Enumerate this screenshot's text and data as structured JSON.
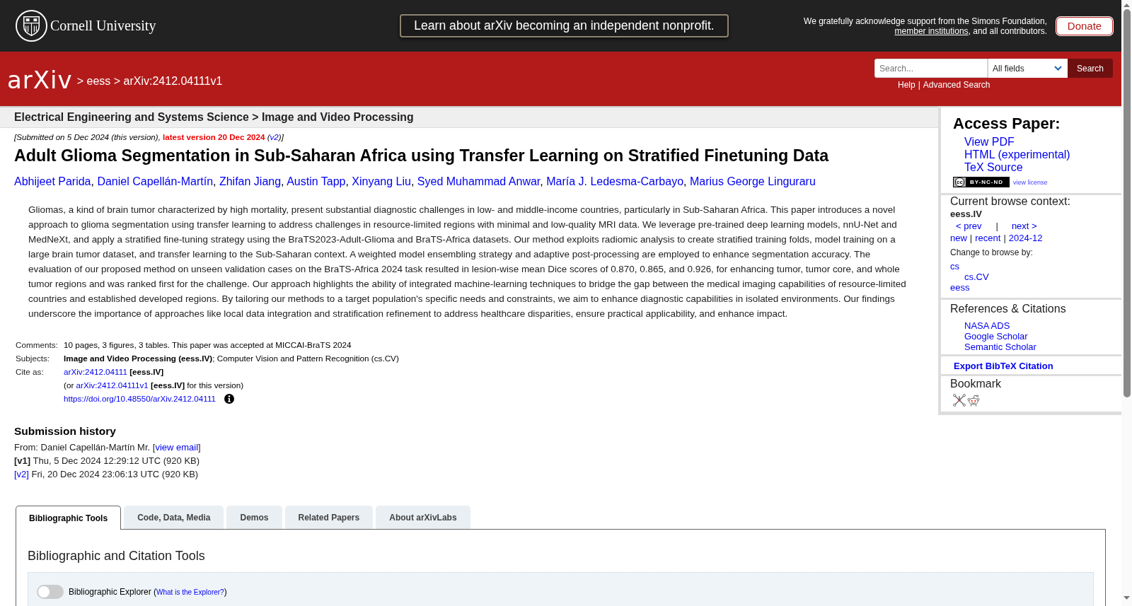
{
  "header": {
    "institution": "Cornell University",
    "banner": "Learn about arXiv becoming an independent nonprofit.",
    "acknowledgment": [
      {
        "kind": "text",
        "text": "We gratefully acknowledge support from the Simons Foundation, "
      },
      {
        "kind": "link",
        "text": "member institutions"
      },
      {
        "kind": "text",
        "text": ", and all contributors."
      }
    ],
    "donate": "Donate"
  },
  "navbar": {
    "logo": "arXiv",
    "breadcrumb": {
      "separator": ">",
      "items": [
        "eess",
        "arXiv:2412.04111v1"
      ]
    },
    "search": {
      "placeholder": "Search...",
      "field": "All fields",
      "button": "Search",
      "links": [
        "Help",
        "Advanced Search"
      ],
      "separator": "|"
    }
  },
  "main": {
    "subject_heading": "Electrical Engineering and Systems Science > Image and Video Processing",
    "dateline": [
      {
        "kind": "text",
        "text": "[Submitted on 5 Dec 2024 (this version), "
      },
      {
        "kind": "highlight_link",
        "text": "latest version 20 Dec 2024"
      },
      {
        "kind": "text",
        "text": " ("
      },
      {
        "kind": "link",
        "text": "v2"
      },
      {
        "kind": "text",
        "text": ")]"
      }
    ],
    "title": "Adult Glioma Segmentation in Sub-Saharan Africa using Transfer Learning on Stratified Finetuning Data",
    "authors": {
      "names": [
        "Abhijeet Parida",
        "Daniel Capellán-Martín",
        "Zhifan Jiang",
        "Austin Tapp",
        "Xinyang Liu",
        "Syed Muhammad Anwar",
        "María J. Ledesma-Carbayo",
        "Marius George Linguraru"
      ],
      "separator": ", "
    },
    "abstract": "Gliomas, a kind of brain tumor characterized by high mortality, present substantial diagnostic challenges in low- and middle-income countries, particularly in Sub-Saharan Africa. This paper introduces a novel approach to glioma segmentation using transfer learning to address challenges in resource-limited regions with minimal and low-quality MRI data. We leverage pre-trained deep learning models, nnU-Net and MedNeXt, and apply a stratified fine-tuning strategy using the BraTS2023-Adult-Glioma and BraTS-Africa datasets. Our method exploits radiomic analysis to create stratified training folds, model training on a large brain tumor dataset, and transfer learning to the Sub-Saharan context. A weighted model ensembling strategy and adaptive post-processing are employed to enhance segmentation accuracy. The evaluation of our proposed method on unseen validation cases on the BraTS-Africa 2024 task resulted in lesion-wise mean Dice scores of 0.870, 0.865, and 0.926, for enhancing tumor, tumor core, and whole tumor regions and was ranked first for the challenge. Our approach highlights the ability of integrated machine-learning techniques to bridge the gap between the medical imaging capabilities of resource-limited countries and established developed regions. By tailoring our methods to a target population's specific needs and constraints, we aim to enhance diagnostic capabilities in isolated environments. Our findings underscore the importance of approaches like local data integration and stratification refinement to address healthcare disparities, ensure practical applicability, and enhance impact.",
    "metadata": [
      {
        "label": "Comments:",
        "lines": [
          {
            "parts": [
              {
                "kind": "text",
                "text": "10 pages, 3 figures, 3 tables. This paper was accepted at MICCAI-BraTS 2024"
              }
            ]
          }
        ]
      },
      {
        "label": "Subjects:",
        "lines": [
          {
            "parts": [
              {
                "kind": "bold",
                "text": "Image and Video Processing (eess.IV)"
              },
              {
                "kind": "text",
                "text": "; Computer Vision and Pattern Recognition (cs.CV)"
              }
            ]
          }
        ]
      },
      {
        "label": "Cite as:",
        "lines": [
          {
            "parts": [
              {
                "kind": "link",
                "text": "arXiv:2412.04111"
              },
              {
                "kind": "bold",
                "text": " [eess.IV]"
              }
            ]
          },
          {
            "parts": [
              {
                "kind": "text",
                "text": "(or "
              },
              {
                "kind": "link",
                "text": "arXiv:2412.04111v1"
              },
              {
                "kind": "bold",
                "text": " [eess.IV]"
              },
              {
                "kind": "text",
                "text": " for this version)"
              }
            ]
          },
          {
            "parts": [
              {
                "kind": "link",
                "text": "https://doi.org/10.48550/arXiv.2412.04111"
              }
            ],
            "info_icon": true
          }
        ]
      }
    ]
  },
  "sidebar": {
    "access": {
      "heading": "Access Paper:",
      "links": [
        "View PDF",
        "HTML (experimental)",
        "TeX Source"
      ],
      "license": {
        "logo": "cc",
        "type": "BY-NC-ND",
        "link": "view license"
      }
    },
    "browse": {
      "heading": "Current browse context:",
      "category": "eess.IV",
      "prev": "< prev",
      "separator": "|",
      "next": "next >",
      "periods": [
        "new",
        "recent",
        "2024-12"
      ],
      "change_label": "Change to browse by:",
      "categories": [
        {
          "label": "cs",
          "children": [
            {
              "label": "cs.CV"
            }
          ]
        },
        {
          "label": "eess"
        }
      ]
    },
    "references": {
      "heading": "References & Citations",
      "links": [
        "NASA ADS",
        "Google Scholar",
        "Semantic Scholar"
      ]
    },
    "export": "Export BibTeX Citation",
    "bookmark": {
      "heading": "Bookmark"
    }
  },
  "submission_history": {
    "heading": "Submission history",
    "lines": [
      [
        {
          "kind": "text",
          "text": "From: Daniel Capellán-Martín Mr. ["
        },
        {
          "kind": "link",
          "text": "view email"
        },
        {
          "kind": "text",
          "text": "]"
        }
      ],
      [
        {
          "kind": "bold",
          "text": "[v1]"
        },
        {
          "kind": "text",
          "text": " Thu, 5 Dec 2024 12:29:12 UTC (920 KB)"
        }
      ],
      [
        {
          "kind": "link",
          "text": "[v2]"
        },
        {
          "kind": "text",
          "text": " Fri, 20 Dec 2024 23:06:13 UTC (920 KB)"
        }
      ]
    ]
  },
  "lab_tabs": {
    "tabs": [
      {
        "label": "Bibliographic Tools",
        "selected": true
      },
      {
        "label": "Code, Data, Media",
        "selected": false
      },
      {
        "label": "Demos",
        "selected": false
      },
      {
        "label": "Related Papers",
        "selected": false
      },
      {
        "label": "About arXivLabs",
        "selected": false
      }
    ],
    "panel": {
      "heading": "Bibliographic and Citation Tools",
      "explorer": {
        "on": false,
        "label": [
          {
            "kind": "text",
            "text": "Bibliographic Explorer ("
          },
          {
            "kind": "link",
            "text": "What is the Explorer?"
          },
          {
            "kind": "text",
            "text": ")"
          }
        ]
      }
    }
  }
}
